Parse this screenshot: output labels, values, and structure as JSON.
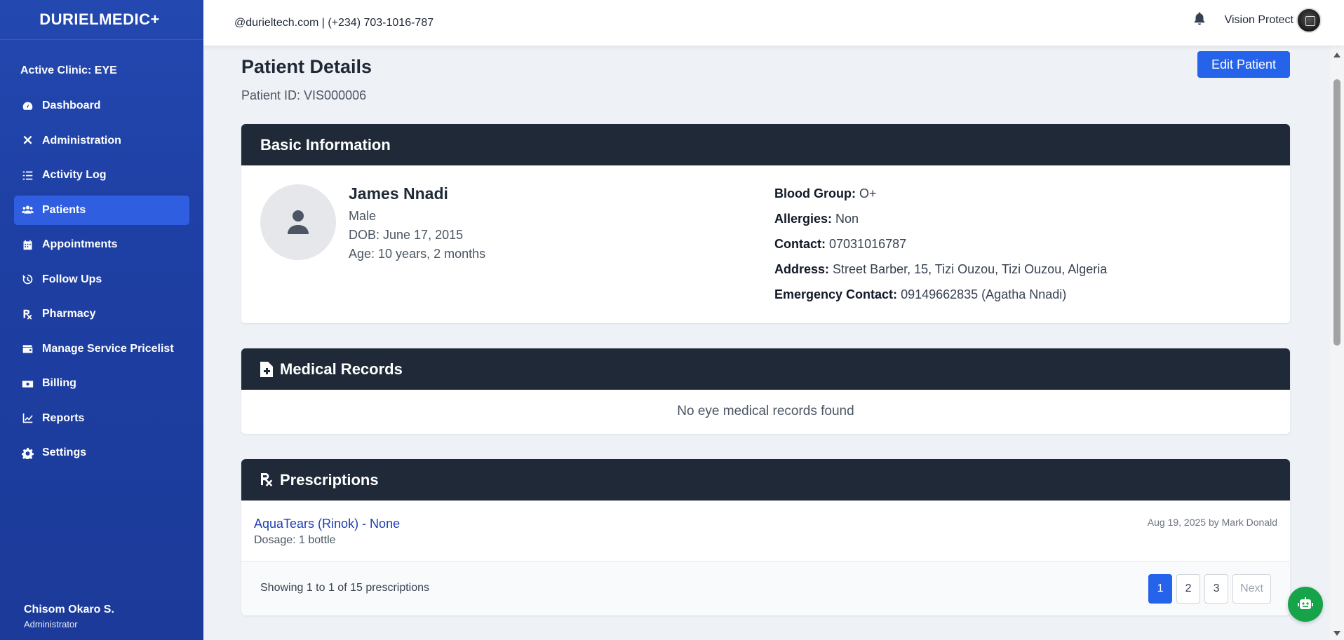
{
  "brand": "DURIELMEDIC+",
  "sidebar": {
    "active_clinic": "Active Clinic: EYE",
    "items": [
      {
        "label": "Dashboard",
        "icon": "gauge-icon"
      },
      {
        "label": "Administration",
        "icon": "tools-icon"
      },
      {
        "label": "Activity Log",
        "icon": "list-check-icon"
      },
      {
        "label": "Patients",
        "icon": "users-icon",
        "active": true
      },
      {
        "label": "Appointments",
        "icon": "calendar-icon"
      },
      {
        "label": "Follow Ups",
        "icon": "history-icon"
      },
      {
        "label": "Pharmacy",
        "icon": "prescription-icon"
      },
      {
        "label": "Manage Service Pricelist",
        "icon": "wallet-icon"
      },
      {
        "label": "Billing",
        "icon": "money-bill-icon"
      },
      {
        "label": "Reports",
        "icon": "chart-line-icon"
      },
      {
        "label": "Settings",
        "icon": "gear-icon"
      }
    ],
    "user": {
      "name": "Chisom Okaro S.",
      "role": "Administrator"
    }
  },
  "topbar": {
    "contact": "@durieltech.com | (+234) 703-1016-787",
    "org_name": "Vision Protect"
  },
  "page": {
    "title": "Patient Details",
    "patient_id": "Patient ID: VIS000006",
    "edit_label": "Edit Patient"
  },
  "basic_info": {
    "heading": "Basic Information",
    "name": "James Nnadi",
    "gender": "Male",
    "dob": "DOB: June 17, 2015",
    "age": "Age: 10 years, 2 months",
    "blood_group_label": "Blood Group:",
    "blood_group": "O+",
    "allergies_label": "Allergies:",
    "allergies": "Non",
    "contact_label": "Contact:",
    "contact": "07031016787",
    "address_label": "Address:",
    "address": "Street Barber, 15, Tizi Ouzou, Tizi Ouzou, Algeria",
    "emergency_label": "Emergency Contact:",
    "emergency": "09149662835 (Agatha Nnadi)"
  },
  "medical_records": {
    "heading": "Medical Records",
    "empty": "No eye medical records found"
  },
  "prescriptions": {
    "heading": "Prescriptions",
    "item": {
      "name": "AquaTears (Rinok) - None",
      "dosage": "Dosage: 1 bottle",
      "meta": "Aug 19, 2025 by Mark Donald"
    },
    "showing": "Showing 1 to 1 of 15 prescriptions",
    "pages": [
      "1",
      "2",
      "3"
    ],
    "next_label": "Next"
  },
  "colors": {
    "sidebar": "#1e3fa3",
    "sidebar_active": "#2f5fe0",
    "card_header": "#1f2937",
    "primary": "#2563eb",
    "chatbot": "#16a34a"
  }
}
